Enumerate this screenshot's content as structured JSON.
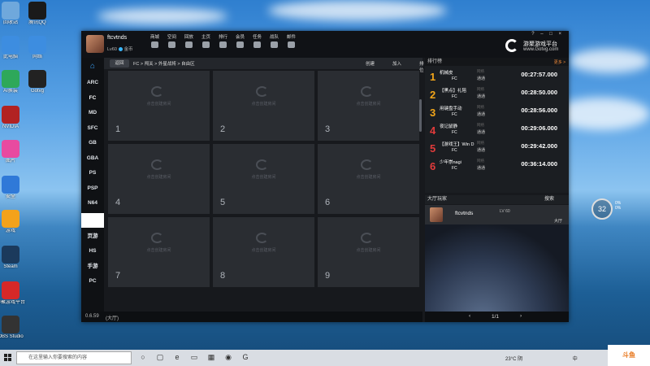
{
  "desktop": {
    "icons": [
      {
        "label": "回收站",
        "icon": "recycle-bin-icon",
        "color": "#6fa8dc"
      },
      {
        "label": "腾讯QQ",
        "icon": "qq-icon",
        "color": "#1a1a1a"
      },
      {
        "label": "此电脑",
        "icon": "computer-icon",
        "color": "#3d8de0"
      },
      {
        "label": "网络",
        "icon": "network-icon",
        "color": "#3d8de0"
      },
      {
        "label": "AI换装",
        "icon": "app-icon",
        "color": "#2ea85a"
      },
      {
        "label": "Gotvg",
        "icon": "app-icon",
        "color": "#222222"
      },
      {
        "label": "NVIDIA",
        "icon": "app-icon",
        "color": "#b22222"
      },
      {
        "label": "图片",
        "icon": "photos-icon",
        "color": "#e84aa0"
      },
      {
        "label": "安全",
        "icon": "shield-icon",
        "color": "#2f79d8"
      },
      {
        "label": "游戏",
        "icon": "game-icon",
        "color": "#f3a21b"
      },
      {
        "label": "Steam",
        "icon": "steam-icon",
        "color": "#1b3a5c"
      },
      {
        "label": "游聚游戏平台",
        "icon": "gotvg-icon",
        "color": "#d62828"
      },
      {
        "label": "OBS Studio",
        "icon": "obs-icon",
        "color": "#333333"
      }
    ]
  },
  "app": {
    "user": {
      "name": "ftcvtnds",
      "level": "Lv60",
      "coin_label": "金币"
    },
    "nav": [
      "商城",
      "空间",
      "回放",
      "主页",
      "排行",
      "会员",
      "任务",
      "战队",
      "邮件"
    ],
    "window_controls": "? – □ ×",
    "logo": {
      "name": "游聚游戏平台",
      "url": "www.Gotvg.com"
    },
    "platforms": [
      "ARC",
      "FC",
      "MD",
      "SFC",
      "GB",
      "GBA",
      "PS",
      "PSP",
      "N64"
    ],
    "platforms2": [
      "页游",
      "HS",
      "手游",
      "PC"
    ],
    "toolbar": {
      "back": "返回",
      "breadcrumb": "FC > 闯关 > 外星战将 > 自由区",
      "actions": [
        "创建",
        "加入",
        "排位",
        "搜索"
      ]
    },
    "grid": {
      "hint": "点击创建房间",
      "rooms": [
        "1",
        "2",
        "3",
        "4",
        "5",
        "6",
        "7",
        "8",
        "9"
      ]
    },
    "footer": {
      "version": "0.6.59",
      "status": "(大厅)"
    },
    "leaderboard": {
      "title": "排行榜",
      "more": "更多 >",
      "status_label": "网络",
      "rows": [
        {
          "rank": "1",
          "name": "机械皮",
          "platform": "FC",
          "status": "通通",
          "time": "00:27:57.000",
          "red": false
        },
        {
          "rank": "2",
          "name": "【黑点】礼陪",
          "platform": "FC",
          "status": "通通",
          "time": "00:28:50.000",
          "red": false
        },
        {
          "rank": "3",
          "name": "用键盘手动",
          "platform": "FC",
          "status": "通通",
          "time": "00:28:56.000",
          "red": false
        },
        {
          "rank": "4",
          "name": "夜记鼠静",
          "platform": "FC",
          "status": "通通",
          "time": "00:29:06.000",
          "red": true
        },
        {
          "rank": "5",
          "name": "【游戏王】Win D",
          "platform": "FC",
          "status": "通通",
          "time": "00:29:42.000",
          "red": true
        },
        {
          "rank": "6",
          "name": "少年崇nagi",
          "platform": "FC",
          "status": "通通",
          "time": "00:36:14.000",
          "red": true
        }
      ]
    },
    "hall": {
      "title": "大厅玩家",
      "search": "搜索",
      "player": {
        "name": "ftcvtnds",
        "level": "LV 60",
        "location": "大厅"
      }
    },
    "pager": {
      "prev": "‹",
      "page": "1/1",
      "next": "›"
    }
  },
  "widget": {
    "value": "32",
    "unit": "%",
    "line1": "0%",
    "line2": "0%"
  },
  "taskbar": {
    "search_placeholder": "在这里输入你要搜索的内容",
    "apps": [
      "search-icon",
      "task-view-icon",
      "edge-icon",
      "folder-icon",
      "store-icon",
      "obs-icon",
      "gotvg-icon"
    ],
    "weather": "23°C 阴",
    "lang": "中"
  },
  "brand": "斗鱼"
}
